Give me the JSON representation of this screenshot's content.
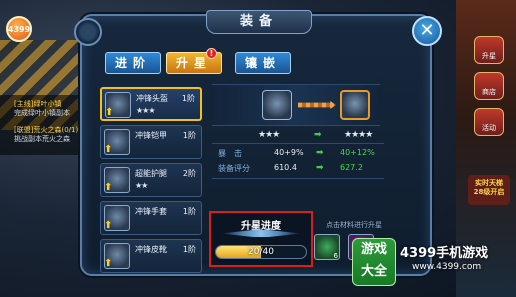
{
  "brand": {
    "logo_text": "4399"
  },
  "window": {
    "title": "装备"
  },
  "tabs": [
    {
      "label": "进阶",
      "state": "normal"
    },
    {
      "label": "升星",
      "state": "active",
      "badge": "!"
    },
    {
      "label": "镶嵌",
      "state": "normal"
    }
  ],
  "background_quests": [
    {
      "title": "[主线]绿叶小镇",
      "desc": "完成绿叶小镇副本"
    },
    {
      "title": "[联盟]荒火之森(0/1)",
      "desc": "挑战副本荒火之森"
    }
  ],
  "side_buttons": [
    "升星",
    "商店",
    "活动"
  ],
  "side_event": {
    "line1": "实时天梯",
    "line2": "28级开启"
  },
  "equipment_list": [
    {
      "name": "冲锋头盔",
      "level": "1阶",
      "stars": "★★★",
      "selected": true
    },
    {
      "name": "冲锋铠甲",
      "level": "1阶",
      "stars": "",
      "selected": false
    },
    {
      "name": "超能护腿",
      "level": "2阶",
      "stars": "★★",
      "selected": false
    },
    {
      "name": "冲锋手套",
      "level": "1阶",
      "stars": "",
      "selected": false
    },
    {
      "name": "冲锋皮靴",
      "level": "1阶",
      "stars": "",
      "selected": false
    }
  ],
  "upgrade": {
    "current_stars": "★★★",
    "next_stars": "★★★★",
    "stats": [
      {
        "label": "暴　击",
        "current": "40+9%",
        "next": "40+12%"
      },
      {
        "label": "装备评分",
        "current": "610.4",
        "next": "627.2"
      }
    ],
    "progress": {
      "title": "升星进度",
      "current": 20,
      "max": 40,
      "text": "20/40"
    },
    "material_hint": "点击材料进行升星",
    "materials": [
      {
        "count": "6"
      },
      {
        "count": ""
      }
    ]
  },
  "colors": {
    "accent_gold": "#f4c01e",
    "highlight_red": "#d8201a",
    "stat_green": "#45dc45"
  },
  "watermark": {
    "badge": "游戏\n大全",
    "name": "4399手机游戏",
    "url": "www.4399.com"
  }
}
